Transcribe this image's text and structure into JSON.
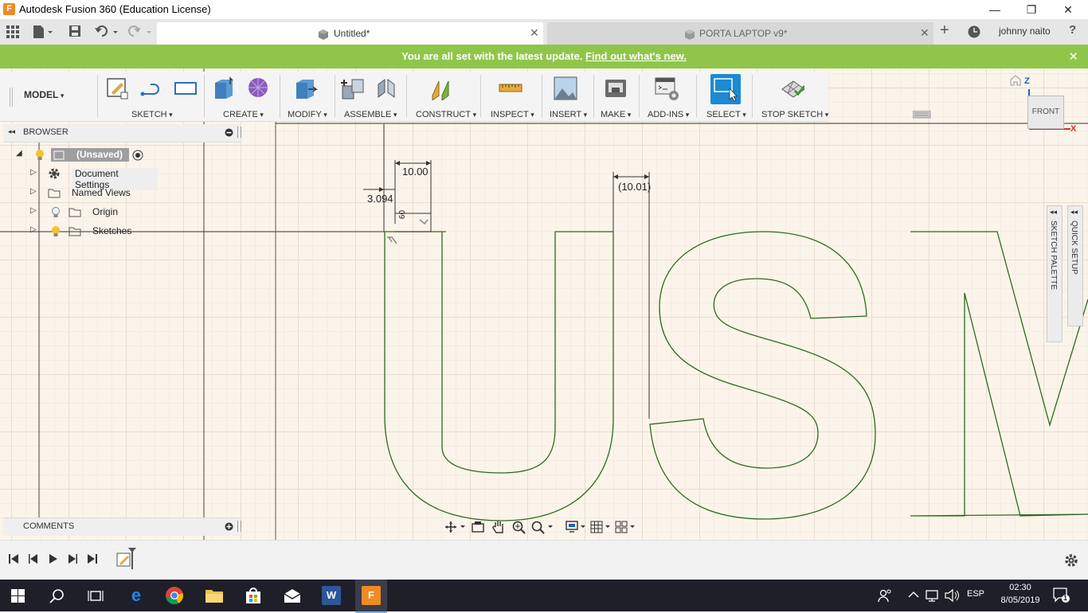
{
  "window": {
    "title": "Autodesk Fusion 360 (Education License)",
    "app_logo": "F",
    "controls": {
      "minimize": "—",
      "restore": "❐",
      "close": "✕"
    }
  },
  "tabs": [
    {
      "label": "Untitled*",
      "active": true
    },
    {
      "label": "PORTA LAPTOP v9*",
      "active": false
    }
  ],
  "tabbar": {
    "user": "johnny naito",
    "add_tab": "+",
    "help": "?"
  },
  "banner": {
    "text": "You are all set with the latest update.",
    "link": "Find out what's new.",
    "close": "✕"
  },
  "toolbar": {
    "workspace": "MODEL",
    "groups": [
      "SKETCH",
      "CREATE",
      "MODIFY",
      "ASSEMBLE",
      "CONSTRUCT",
      "INSPECT",
      "INSERT",
      "MAKE",
      "ADD-INS",
      "SELECT",
      "STOP SKETCH"
    ]
  },
  "browser": {
    "title": "BROWSER",
    "root": "(Unsaved)",
    "items": [
      "Document Settings",
      "Named Views",
      "Origin",
      "Sketches"
    ]
  },
  "comments": {
    "title": "COMMENTS"
  },
  "viewcube": {
    "face": "FRONT",
    "axis_z": "Z",
    "axis_x": "X"
  },
  "palettes": {
    "sketch": "SKETCH PALETTE",
    "quick": "QUICK SETUP"
  },
  "dimensions": {
    "d1": "10.00",
    "d2": "3.094",
    "d3": "(10.01)",
    "d4": "60"
  },
  "taskbar": {
    "lang": "ESP",
    "time": "02:30",
    "date": "8/05/2019",
    "notifications": "1"
  },
  "colors": {
    "banner": "#8fc64a",
    "canvas": "#fbf4ea",
    "sketch_line": "#2e6b1f",
    "select_active": "#1b8ad3",
    "taskbar": "#1f1f2a"
  }
}
